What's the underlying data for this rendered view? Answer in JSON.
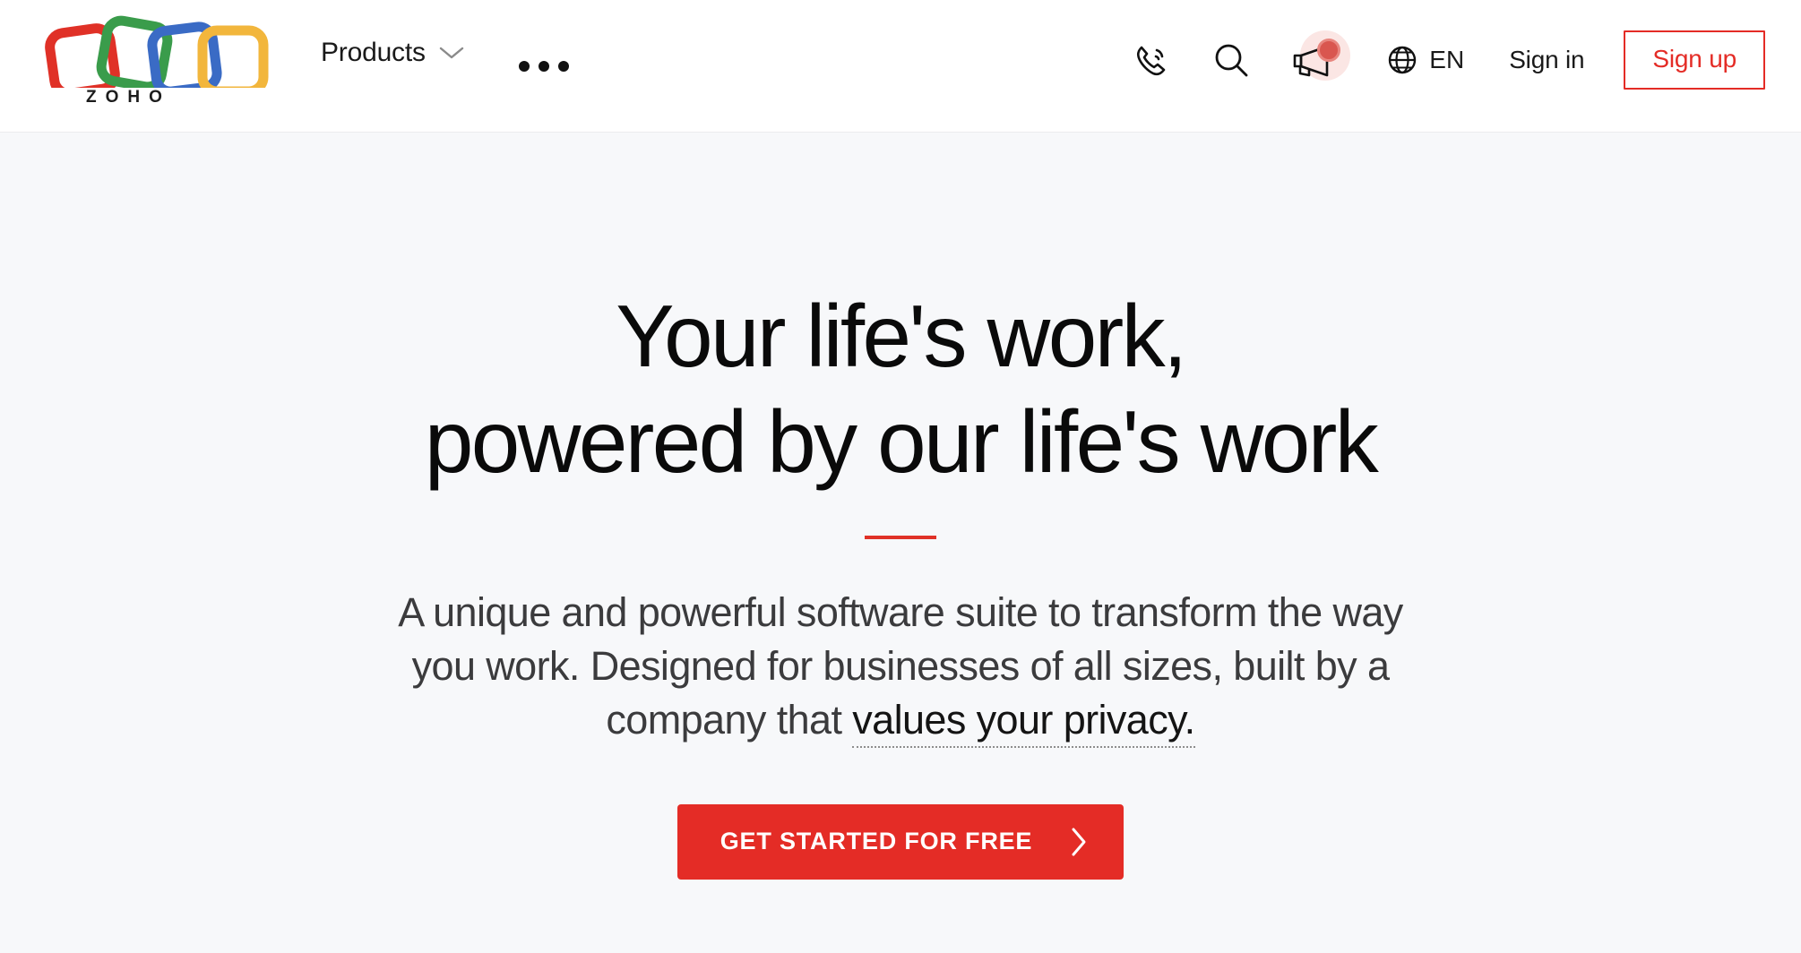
{
  "brand": {
    "name": "ZOHO",
    "logo_icon": "zoho-logo-icon",
    "colors": {
      "red": "#e03127",
      "green": "#3a9c4b",
      "blue": "#3a6bc5",
      "yellow": "#f2b63c",
      "accent": "#e42c26",
      "header_bg": "#ffffff",
      "hero_bg": "#f7f8fa",
      "headline_text": "#0a0a0a",
      "body_text": "#3b3b3d"
    }
  },
  "header": {
    "nav": {
      "products_label": "Products",
      "products_chevron_icon": "chevron-down-icon",
      "more_icon": "more-horizontal-icon"
    },
    "actions": {
      "phone_icon": "phone-icon",
      "search_icon": "search-icon",
      "announcement_icon": "megaphone-icon",
      "announcement_badge": "notification-dot",
      "language_icon": "globe-icon",
      "language_label": "EN",
      "signin_label": "Sign in",
      "signup_label": "Sign up"
    }
  },
  "hero": {
    "headline_line1": "Your life's work,",
    "headline_line2": "powered by our life's work",
    "subtitle_part1": "A unique and powerful software suite to transform the way you work. Designed for businesses of all sizes, built by a company that ",
    "subtitle_link": "values your privacy.",
    "cta_label": "GET STARTED FOR FREE",
    "cta_chevron_icon": "chevron-right-icon"
  }
}
